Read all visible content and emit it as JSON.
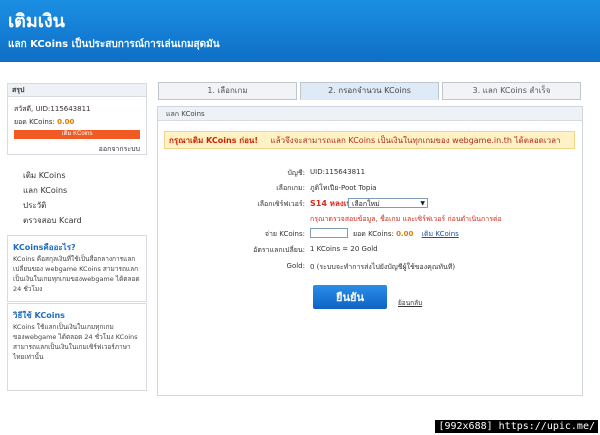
{
  "header": {
    "title": "เติมเงิน",
    "subtitle": "แลก KCoins เป็นประสบการณ์การเล่นเกมสุดมัน"
  },
  "sidebar": {
    "summary_title": "สรุป",
    "greeting": "สวัสดี, UID:115643811",
    "balance_label": "ยอด KCoins:",
    "balance_value": "0.00",
    "topup_button": "เติม KCoins",
    "logout": "ออกจากระบบ",
    "menu": [
      {
        "label": "เติม KCoins"
      },
      {
        "label": "แลก KCoins"
      },
      {
        "label": "ประวัติ"
      },
      {
        "label": "ตรวจสอบ Kcard"
      }
    ],
    "info1": {
      "title": "KCoinsคืออะไร?",
      "body": "KCoins คือสกุลเงินที่ใช้เป็นสื่อกลางการแลกเปลี่ยนของ webgame KCoins สามารถแลกเป็นเงินในเกมทุกเกมของwebgame ได้ตลอด 24 ชั่วโมง"
    },
    "info2": {
      "title": "วิธีใช้ KCoins",
      "body": "KCoins ใช้แลกเป็นเงินในเกมทุกเกมของwebgame ได้ตลอด 24 ชั่วโมง KCoins สามารถแลกเป็นเงินในเกมเซิร์ฟเวอร์ภาษาไทยเท่านั้น"
    }
  },
  "tabs": [
    {
      "label": "1. เลือกเกม",
      "active": false
    },
    {
      "label": "2. กรอกจำนวน KCoins",
      "active": true
    },
    {
      "label": "3. แลก KCoins สำเร็จ",
      "active": false
    }
  ],
  "panel": {
    "title": "แลก KCoins",
    "notice_warn": "กรุณาเติม KCoins ก่อน!",
    "notice_msg": "แล้วจึงจะสามารถแลก KCoins เป็นเงินในทุกเกมของ webgame.in.th ได้ตลอดเวลา",
    "account_label": "บัญชี:",
    "account_value": "UID:115643811",
    "game_label": "เลือกเกม:",
    "game_value": "ภูติโทเปีย-Poot Topia",
    "server_label": "เลือกเซิร์ฟเวอร์:",
    "server_value": "S14 หลงเทวา",
    "server_select": "เลือกใหม่",
    "server_hint": "กรุณาตรวจสอบข้อมูล, ชื่อเกม และเซิร์ฟเวอร์ ก่อนดำเนินการต่อ",
    "pay_label": "จ่าย KCoins:",
    "pay_balance_label": "ยอด KCoins:",
    "pay_balance_value": "0.00",
    "pay_topup_link": "เติม KCoins",
    "rate_label": "อัตราแลกเปลี่ยน:",
    "rate_value": "1 KCoins = 20 Gold",
    "gold_label": "Gold:",
    "gold_value": "0 (ระบบจะทำการส่งไปยังบัญชีผู้ใช้ของคุณทันที)",
    "confirm_button": "ยืนยัน",
    "back_link": "ย้อนกลับ"
  },
  "watermark": "[992x688] https://upic.me/"
}
